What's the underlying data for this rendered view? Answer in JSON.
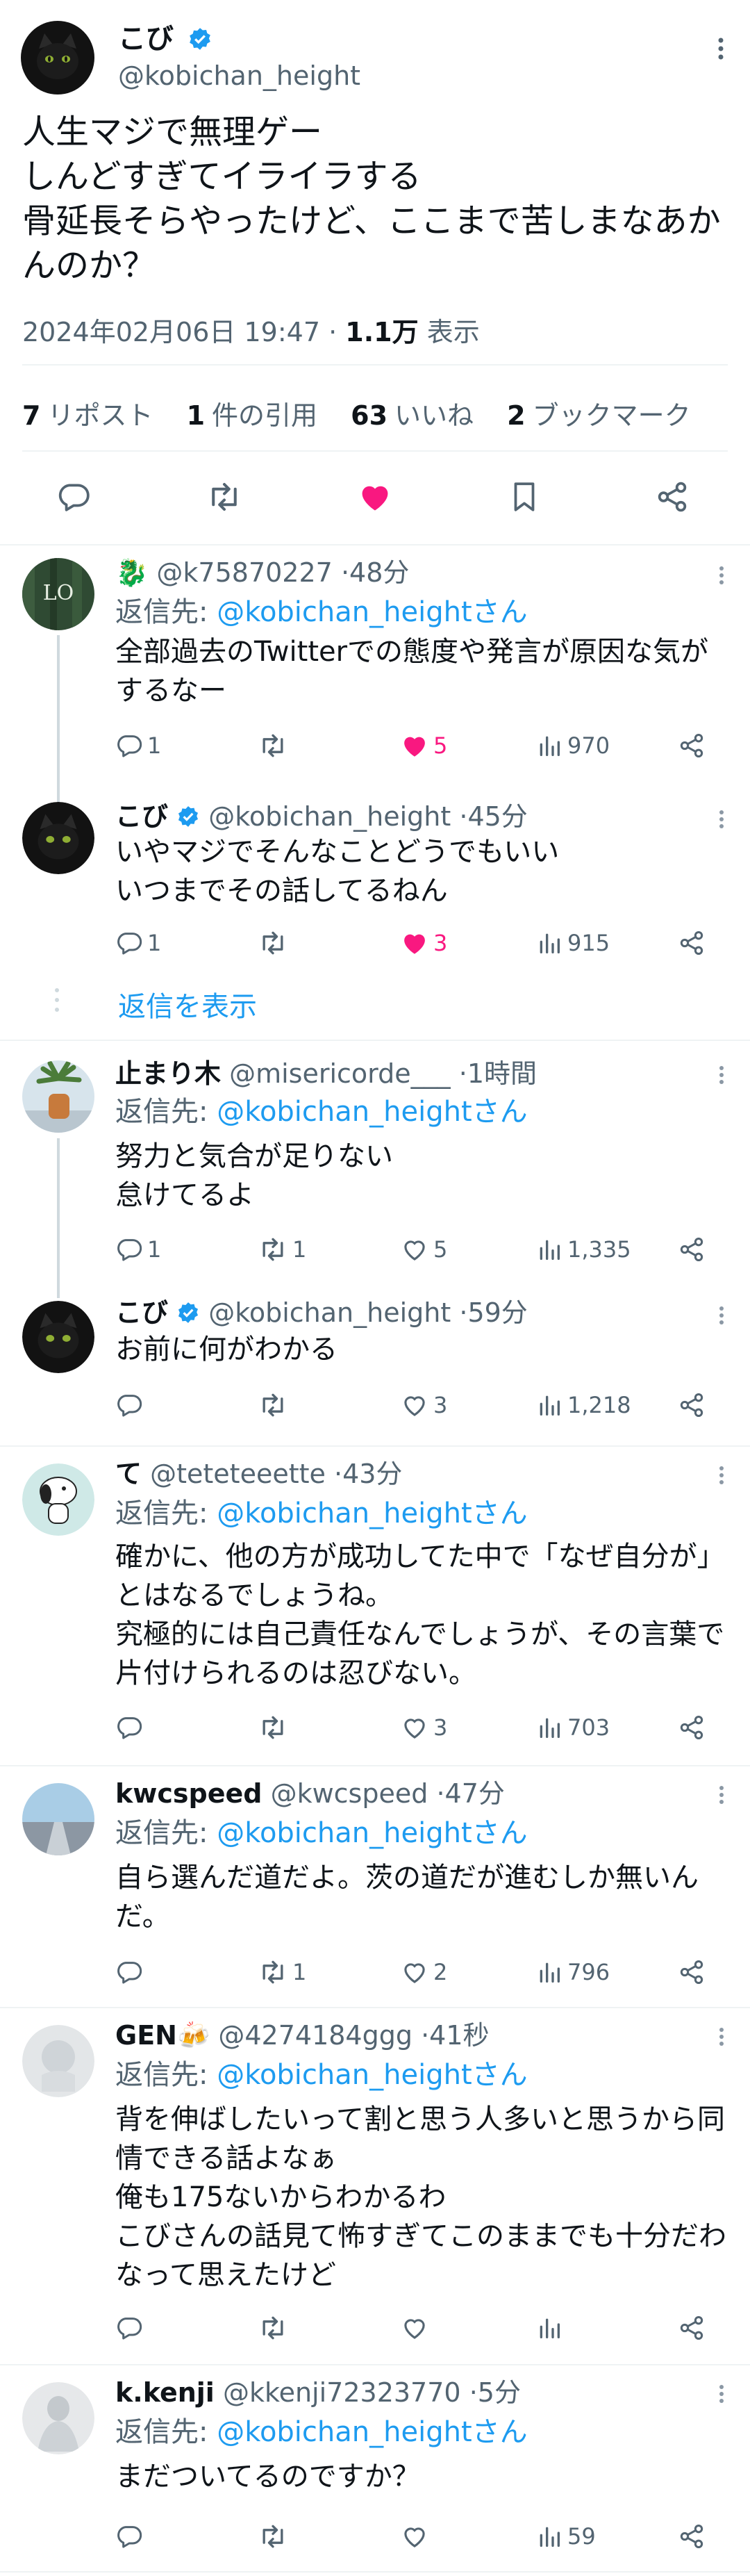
{
  "main_tweet": {
    "name": "こび",
    "handle": "@kobichan_height",
    "text": "人生マジで無理ゲー\nしんどすぎてイライラする\n骨延長そらやったけど、ここまで苦しまなあかんのか？",
    "datetime": "2024年02月06日 19:47",
    "view_count": "1.1万",
    "view_label": "表示",
    "stats": [
      {
        "num": "7",
        "label": "リポスト"
      },
      {
        "num": "1",
        "label": "件の引用"
      },
      {
        "num": "63",
        "label": "いいね"
      },
      {
        "num": "2",
        "label": "ブックマーク"
      }
    ]
  },
  "reply_to_label": "返信先:",
  "reply_to_handle": "@kobichan_heightさん",
  "show_replies_label": "返信を表示",
  "replies": [
    {
      "name": "",
      "badge": "🐉",
      "handle": "@k75870227",
      "time": "48分",
      "text": "全部過去のTwitterでの態度や発言が原因な気がするなー",
      "replies": "1",
      "retweets": "",
      "likes": "5",
      "views": "970",
      "liked": true
    },
    {
      "name": "こび",
      "handle": "@kobichan_height",
      "time": "45分",
      "text": "いやマジでそんなことどうでもいい\nいつまでその話してるねん",
      "replies": "1",
      "retweets": "",
      "likes": "3",
      "views": "915",
      "liked": true
    },
    {
      "name": "止まり木",
      "handle": "@misericorde___",
      "time": "1時間",
      "text": "努力と気合が足りない\n怠けてるよ",
      "replies": "1",
      "retweets": "1",
      "likes": "5",
      "views": "1,335",
      "liked": false
    },
    {
      "name": "こび",
      "handle": "@kobichan_height",
      "time": "59分",
      "text": "お前に何がわかる",
      "replies": "",
      "retweets": "",
      "likes": "3",
      "views": "1,218",
      "liked": false
    },
    {
      "name": "て",
      "handle": "@teteteeette",
      "time": "43分",
      "text": "確かに、他の方が成功してた中で「なぜ自分が」とはなるでしょうね。\n究極的には自己責任なんでしょうが、その言葉で片付けられるのは忍びない。",
      "replies": "",
      "retweets": "",
      "likes": "3",
      "views": "703",
      "liked": false
    },
    {
      "name": "kwcspeed",
      "handle": "@kwcspeed",
      "time": "47分",
      "text": "自ら選んだ道だよ。茨の道だが進むしか無いんだ。",
      "replies": "",
      "retweets": "1",
      "likes": "2",
      "views": "796",
      "liked": false
    },
    {
      "name": "GEN🍻",
      "handle": "@4274184ggg",
      "time": "41秒",
      "text": "背を伸ばしたいって割と思う人多いと思うから同情できる話よなぁ\n俺も175ないからわかるわ\nこびさんの話見て怖すぎてこのままでも十分だわなって思えたけど",
      "replies": "",
      "retweets": "",
      "likes": "",
      "views": "",
      "liked": false
    },
    {
      "name": "k.kenji",
      "handle": "@kkenji72323770",
      "time": "5分",
      "text": "まだついてるのですか？",
      "replies": "",
      "retweets": "",
      "likes": "",
      "views": "59",
      "liked": false
    }
  ],
  "colors": {
    "accent": "#1d9bf0",
    "like": "#f91880",
    "secondary_text": "#536471",
    "divider": "#eff3f4"
  }
}
